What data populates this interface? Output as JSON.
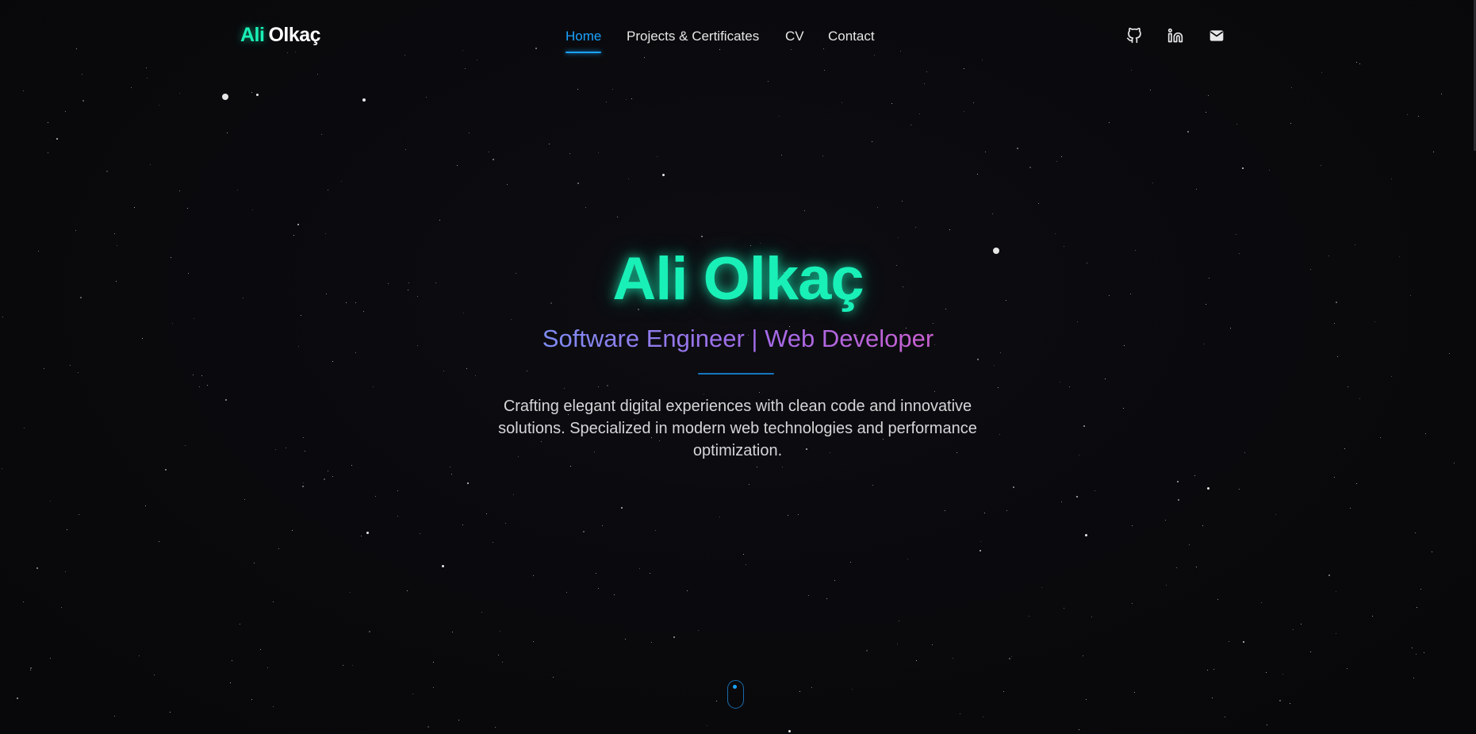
{
  "header": {
    "logo": {
      "first": "Ali",
      "last": "Olkaç"
    },
    "nav": [
      {
        "label": "Home",
        "active": true
      },
      {
        "label": "Projects & Certificates",
        "active": false
      },
      {
        "label": "CV",
        "active": false
      },
      {
        "label": "Contact",
        "active": false
      }
    ],
    "social": [
      {
        "icon": "github-icon"
      },
      {
        "icon": "linkedin-icon"
      },
      {
        "icon": "mail-icon"
      }
    ]
  },
  "hero": {
    "title": "Ali Olkaç",
    "subtitle": "Software Engineer | Web Developer",
    "description": "Crafting elegant digital experiences with clean code and innovative solutions. Specialized in modern web technologies and performance optimization."
  },
  "scroll_indicator": {
    "icon": "mouse-scroll-icon"
  },
  "colors": {
    "accent_green": "#19f0b7",
    "accent_blue": "#1aa3ff",
    "gradient_start": "#7e8cf2",
    "gradient_end": "#c85fd0",
    "background": "#0a0a0e"
  }
}
